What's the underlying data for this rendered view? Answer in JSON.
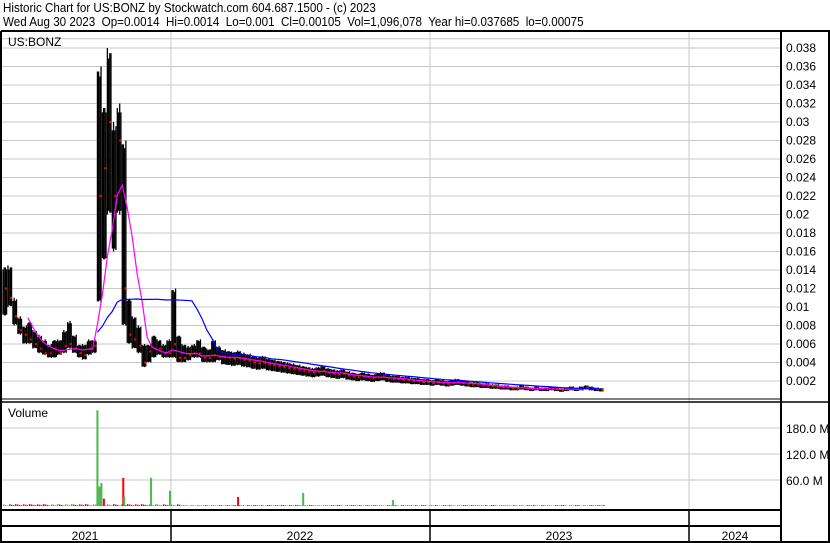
{
  "header": {
    "title": "Historic Chart for US:BONZ by Stockwatch.com 604.687.1500 - (c) 2023",
    "quote": "Wed Aug 30 2023  Op=0.0014  Hi=0.0014  Lo=0.001  Cl=0.00105  Vol=1,096,078  Year hi=0.037685  lo=0.00075"
  },
  "chart_data": {
    "type": "line",
    "title": "US:BONZ",
    "volume_label": "Volume",
    "x_axis": {
      "labels": [
        "2021",
        "2022",
        "2023",
        "2024"
      ],
      "start": "2021-05-08",
      "end": "2023-08-30",
      "interval": "weekly"
    },
    "price_axis": {
      "ylim": [
        0,
        0.039
      ],
      "ticks": [
        "0.002",
        "0.004",
        "0.006",
        "0.008",
        "0.01",
        "0.012",
        "0.014",
        "0.016",
        "0.018",
        "0.02",
        "0.022",
        "0.024",
        "0.026",
        "0.028",
        "0.03",
        "0.032",
        "0.034",
        "0.036",
        "0.038"
      ]
    },
    "volume_axis": {
      "ylim": [
        0,
        230
      ],
      "unit": "M",
      "ticks": [
        "60.0 M",
        "120.0 M",
        "180.0 M"
      ],
      "tick_values": [
        60,
        120,
        180
      ]
    },
    "price": {
      "high": [
        0.0145,
        0.0145,
        0.011,
        0.009,
        0.008,
        0.0085,
        0.0075,
        0.007,
        0.0065,
        0.006,
        0.0065,
        0.0065,
        0.0075,
        0.0085,
        0.007,
        0.006,
        0.006,
        0.0065,
        0.0065,
        0.036,
        0.032,
        0.038,
        0.03,
        0.032,
        0.028,
        0.011,
        0.009,
        0.008,
        0.006,
        0.006,
        0.007,
        0.0065,
        0.006,
        0.0065,
        0.012,
        0.007,
        0.006,
        0.0058,
        0.006,
        0.0065,
        0.0058,
        0.0055,
        0.0065,
        0.0058
      ],
      "low": [
        0.009,
        0.01,
        0.008,
        0.007,
        0.006,
        0.006,
        0.0055,
        0.005,
        0.0048,
        0.0045,
        0.0045,
        0.0048,
        0.005,
        0.0055,
        0.005,
        0.0045,
        0.0043,
        0.0048,
        0.005,
        0.0105,
        0.015,
        0.02,
        0.016,
        0.02,
        0.008,
        0.006,
        0.0055,
        0.005,
        0.0035,
        0.004,
        0.0045,
        0.0048,
        0.0045,
        0.0045,
        0.0045,
        0.004,
        0.004,
        0.0042,
        0.0045,
        0.0045,
        0.004,
        0.004,
        0.004,
        0.0042
      ],
      "close": [
        0.012,
        0.011,
        0.009,
        0.0075,
        0.007,
        0.0065,
        0.006,
        0.0055,
        0.005,
        0.005,
        0.0055,
        0.005,
        0.0058,
        0.006,
        0.0055,
        0.005,
        0.0048,
        0.0055,
        0.0058,
        0.022,
        0.025,
        0.03,
        0.022,
        0.028,
        0.012,
        0.007,
        0.0065,
        0.0058,
        0.004,
        0.0052,
        0.0055,
        0.0055,
        0.005,
        0.005,
        0.006,
        0.0045,
        0.0045,
        0.0048,
        0.005,
        0.005,
        0.0045,
        0.0045,
        0.0048,
        0.0046,
        0.0046,
        0.0045,
        0.0044,
        0.0045,
        0.0043,
        0.0042,
        0.004,
        0.0039,
        0.004,
        0.0038,
        0.0037,
        0.0036,
        0.0035,
        0.0034,
        0.0033,
        0.0032,
        0.0031,
        0.003,
        0.0029,
        0.003,
        0.0031,
        0.0029,
        0.0028,
        0.0027,
        0.0028,
        0.0026,
        0.0025,
        0.0024,
        0.0025,
        0.0024,
        0.0023,
        0.0024,
        0.0025,
        0.0023,
        0.0022,
        0.0022,
        0.0021,
        0.0021,
        0.002,
        0.002,
        0.0019,
        0.0019,
        0.0018,
        0.0019,
        0.0018,
        0.0017,
        0.0018,
        0.0019,
        0.0018,
        0.0017,
        0.0016,
        0.0016,
        0.0015,
        0.0015,
        0.0014,
        0.0014,
        0.0013,
        0.0013,
        0.0012,
        0.0012,
        0.0013,
        0.0012,
        0.0011,
        0.0012,
        0.0011,
        0.0011,
        0.0012,
        0.0011,
        0.001,
        0.0011,
        0.0012,
        0.0011,
        0.0012,
        0.0013,
        0.0012,
        0.0011,
        0.00105
      ]
    },
    "moving_averages": [
      {
        "name": "short MA",
        "period_weeks": 6,
        "color": "#ff00ff"
      },
      {
        "name": "long MA",
        "period_weeks": 20,
        "color": "#0000ff"
      }
    ],
    "volume_spikes_M": [
      {
        "week": 19,
        "value": 221,
        "color": "#4cb84c"
      },
      {
        "week": 19.4,
        "value": 45,
        "color": "#4cb84c"
      },
      {
        "week": 19.8,
        "value": 53,
        "color": "#4cb84c"
      },
      {
        "week": 20.3,
        "value": 17,
        "color": "#ff0000"
      },
      {
        "week": 24.2,
        "value": 65,
        "color": "#ff0000"
      },
      {
        "week": 24.4,
        "value": 22,
        "color": "#4cb84c"
      },
      {
        "week": 29.8,
        "value": 65,
        "color": "#4cb84c"
      },
      {
        "week": 33.6,
        "value": 35,
        "color": "#4cb84c"
      },
      {
        "week": 47.3,
        "value": 21,
        "color": "#ff0000"
      },
      {
        "week": 60.4,
        "value": 30,
        "color": "#4cb84c"
      },
      {
        "week": 78.5,
        "value": 14,
        "color": "#4cb84c"
      }
    ],
    "volume_baseline_M": 2,
    "colors": {
      "price_bar": "#000000",
      "close_tick": "#ff0000",
      "grid": "#c8c8c8",
      "up_volume": "#4cb84c",
      "down_volume": "#ff0000"
    }
  }
}
